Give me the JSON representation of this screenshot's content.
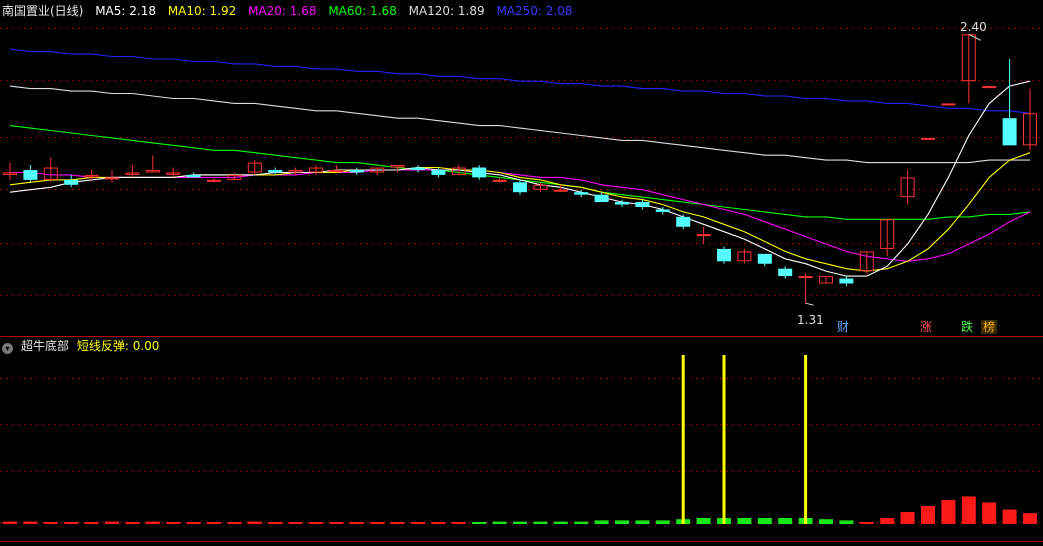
{
  "main_header": {
    "title": "南国置业(日线)",
    "ma": [
      {
        "label": "MA5: 2.18",
        "color": "#ffffff"
      },
      {
        "label": "MA10: 1.92",
        "color": "#ffff00"
      },
      {
        "label": "MA20: 1.68",
        "color": "#ff00ff"
      },
      {
        "label": "MA60: 1.68",
        "color": "#00ff00"
      },
      {
        "label": "MA120: 1.89",
        "color": "#dddddd"
      },
      {
        "label": "MA250: 2.08",
        "color": "#2222ff"
      }
    ]
  },
  "sub_header": {
    "indicator": "超牛底部",
    "line_label": "短线反弹: 0.00"
  },
  "annotations": {
    "high": "2.40",
    "low": "1.31",
    "tag_cai": "财",
    "tag_zhang": "涨",
    "tag_die": "跌",
    "tag_bang": "榜"
  },
  "colors": {
    "up": "#ff3232",
    "down": "#54ffff",
    "ma5": "#ffffff",
    "ma10": "#ffff00",
    "ma20": "#ff00ff",
    "ma60": "#00ff00",
    "ma120": "#dddddd",
    "ma250": "#2222ff",
    "signal": "#ffff00",
    "grid": "#8a0000"
  },
  "chart_data": {
    "type": "candlestick",
    "price_range": [
      1.25,
      2.45
    ],
    "candles": [
      [
        1.83,
        1.84,
        1.88,
        1.81
      ],
      [
        1.85,
        1.81,
        1.87,
        1.8
      ],
      [
        1.81,
        1.86,
        1.9,
        1.8
      ],
      [
        1.81,
        1.79,
        1.83,
        1.78
      ],
      [
        1.82,
        1.83,
        1.85,
        1.81
      ],
      [
        1.82,
        1.82,
        1.85,
        1.8
      ],
      [
        1.83,
        1.84,
        1.87,
        1.82
      ],
      [
        1.84,
        1.85,
        1.91,
        1.84
      ],
      [
        1.83,
        1.84,
        1.86,
        1.82
      ],
      [
        1.83,
        1.82,
        1.84,
        1.82
      ],
      [
        1.81,
        1.81,
        1.82,
        1.8
      ],
      [
        1.81,
        1.83,
        1.84,
        1.81
      ],
      [
        1.84,
        1.88,
        1.89,
        1.83
      ],
      [
        1.85,
        1.84,
        1.86,
        1.83
      ],
      [
        1.84,
        1.85,
        1.86,
        1.83
      ],
      [
        1.84,
        1.86,
        1.87,
        1.83
      ],
      [
        1.85,
        1.85,
        1.87,
        1.84
      ],
      [
        1.85,
        1.84,
        1.86,
        1.83
      ],
      [
        1.84,
        1.86,
        1.86,
        1.83
      ],
      [
        1.86,
        1.87,
        1.87,
        1.84
      ],
      [
        1.86,
        1.85,
        1.87,
        1.84
      ],
      [
        1.85,
        1.83,
        1.86,
        1.82
      ],
      [
        1.83,
        1.86,
        1.87,
        1.83
      ],
      [
        1.86,
        1.82,
        1.87,
        1.81
      ],
      [
        1.81,
        1.81,
        1.82,
        1.8
      ],
      [
        1.8,
        1.76,
        1.81,
        1.75
      ],
      [
        1.77,
        1.79,
        1.8,
        1.76
      ],
      [
        1.77,
        1.77,
        1.79,
        1.76
      ],
      [
        1.76,
        1.75,
        1.77,
        1.74
      ],
      [
        1.75,
        1.72,
        1.76,
        1.72
      ],
      [
        1.72,
        1.71,
        1.73,
        1.7
      ],
      [
        1.72,
        1.7,
        1.73,
        1.69
      ],
      [
        1.69,
        1.68,
        1.7,
        1.67
      ],
      [
        1.66,
        1.62,
        1.67,
        1.61
      ],
      [
        1.59,
        1.59,
        1.62,
        1.55
      ],
      [
        1.53,
        1.48,
        1.54,
        1.47
      ],
      [
        1.48,
        1.52,
        1.53,
        1.47
      ],
      [
        1.51,
        1.47,
        1.51,
        1.46
      ],
      [
        1.45,
        1.42,
        1.46,
        1.41
      ],
      [
        1.42,
        1.42,
        1.43,
        1.31
      ],
      [
        1.39,
        1.42,
        1.42,
        1.39
      ],
      [
        1.41,
        1.39,
        1.42,
        1.38
      ],
      [
        1.44,
        1.52,
        1.52,
        1.43
      ],
      [
        1.53,
        1.65,
        1.65,
        1.5
      ],
      [
        1.74,
        1.82,
        1.85,
        1.71
      ],
      [
        1.98,
        1.98,
        1.98,
        1.98
      ],
      [
        2.12,
        2.12,
        2.12,
        2.12
      ],
      [
        2.21,
        2.4,
        2.4,
        2.12
      ],
      [
        2.19,
        2.19,
        2.19,
        2.19
      ],
      [
        2.06,
        1.95,
        2.3,
        1.95
      ],
      [
        1.95,
        2.08,
        2.18,
        1.93
      ]
    ],
    "ma5": [
      1.76,
      1.77,
      1.78,
      1.8,
      1.81,
      1.82,
      1.82,
      1.82,
      1.82,
      1.83,
      1.83,
      1.83,
      1.83,
      1.84,
      1.84,
      1.84,
      1.85,
      1.85,
      1.85,
      1.85,
      1.86,
      1.85,
      1.85,
      1.84,
      1.83,
      1.81,
      1.79,
      1.78,
      1.76,
      1.74,
      1.72,
      1.71,
      1.69,
      1.66,
      1.63,
      1.6,
      1.57,
      1.53,
      1.49,
      1.47,
      1.44,
      1.42,
      1.42,
      1.46,
      1.55,
      1.67,
      1.82,
      1.99,
      2.12,
      2.19,
      2.21
    ],
    "ma10": [
      1.79,
      1.8,
      1.81,
      1.81,
      1.82,
      1.82,
      1.82,
      1.82,
      1.82,
      1.83,
      1.83,
      1.83,
      1.83,
      1.83,
      1.84,
      1.84,
      1.84,
      1.85,
      1.85,
      1.85,
      1.86,
      1.86,
      1.85,
      1.85,
      1.84,
      1.82,
      1.81,
      1.79,
      1.78,
      1.76,
      1.74,
      1.73,
      1.71,
      1.68,
      1.66,
      1.63,
      1.6,
      1.56,
      1.52,
      1.49,
      1.47,
      1.45,
      1.44,
      1.45,
      1.48,
      1.53,
      1.61,
      1.71,
      1.82,
      1.89,
      1.92
    ],
    "ma20": [
      1.84,
      1.84,
      1.83,
      1.83,
      1.82,
      1.82,
      1.82,
      1.82,
      1.82,
      1.82,
      1.82,
      1.82,
      1.83,
      1.83,
      1.83,
      1.84,
      1.84,
      1.84,
      1.85,
      1.85,
      1.85,
      1.85,
      1.85,
      1.85,
      1.84,
      1.83,
      1.82,
      1.82,
      1.81,
      1.79,
      1.78,
      1.77,
      1.75,
      1.73,
      1.71,
      1.69,
      1.67,
      1.64,
      1.61,
      1.58,
      1.55,
      1.52,
      1.5,
      1.49,
      1.48,
      1.49,
      1.51,
      1.55,
      1.59,
      1.64,
      1.68
    ],
    "ma60": [
      2.03,
      2.02,
      2.01,
      2.0,
      1.99,
      1.98,
      1.97,
      1.96,
      1.95,
      1.94,
      1.93,
      1.93,
      1.92,
      1.91,
      1.9,
      1.89,
      1.88,
      1.88,
      1.87,
      1.86,
      1.85,
      1.85,
      1.84,
      1.83,
      1.82,
      1.81,
      1.8,
      1.79,
      1.78,
      1.76,
      1.75,
      1.74,
      1.73,
      1.72,
      1.71,
      1.7,
      1.69,
      1.68,
      1.67,
      1.66,
      1.66,
      1.65,
      1.65,
      1.65,
      1.65,
      1.65,
      1.66,
      1.66,
      1.67,
      1.67,
      1.68
    ],
    "ma120": [
      2.19,
      2.18,
      2.18,
      2.17,
      2.17,
      2.16,
      2.16,
      2.15,
      2.14,
      2.14,
      2.13,
      2.12,
      2.12,
      2.11,
      2.1,
      2.09,
      2.09,
      2.08,
      2.07,
      2.06,
      2.06,
      2.05,
      2.04,
      2.03,
      2.03,
      2.02,
      2.01,
      2.0,
      1.99,
      1.98,
      1.97,
      1.97,
      1.96,
      1.95,
      1.94,
      1.93,
      1.92,
      1.91,
      1.91,
      1.9,
      1.89,
      1.89,
      1.88,
      1.88,
      1.88,
      1.88,
      1.88,
      1.88,
      1.89,
      1.89,
      1.89
    ],
    "ma250": [
      2.34,
      2.33,
      2.33,
      2.32,
      2.32,
      2.31,
      2.31,
      2.3,
      2.3,
      2.29,
      2.29,
      2.28,
      2.28,
      2.27,
      2.27,
      2.26,
      2.26,
      2.25,
      2.25,
      2.24,
      2.24,
      2.23,
      2.23,
      2.22,
      2.22,
      2.21,
      2.21,
      2.2,
      2.2,
      2.19,
      2.19,
      2.18,
      2.18,
      2.17,
      2.17,
      2.16,
      2.16,
      2.15,
      2.15,
      2.14,
      2.14,
      2.13,
      2.13,
      2.12,
      2.12,
      2.11,
      2.1,
      2.1,
      2.09,
      2.09,
      2.08
    ],
    "indicator": {
      "bars": [
        0.02,
        0.02,
        0.01,
        0.01,
        0.01,
        0.02,
        0.01,
        0.02,
        0.01,
        0.01,
        0,
        0,
        0.02,
        0.01,
        0.01,
        0.01,
        0.01,
        0.01,
        0.01,
        0.01,
        0.01,
        0.01,
        0,
        -0.01,
        -0.02,
        -0.02,
        -0.02,
        -0.02,
        -0.02,
        -0.03,
        -0.03,
        -0.03,
        -0.03,
        -0.04,
        -0.05,
        -0.05,
        -0.05,
        -0.05,
        -0.05,
        -0.05,
        -0.04,
        -0.03,
        0.01,
        0.05,
        0.1,
        0.15,
        0.2,
        0.23,
        0.18,
        0.12,
        0.09
      ],
      "signals": [
        33,
        35,
        39
      ],
      "signal_value": 1.0
    }
  }
}
